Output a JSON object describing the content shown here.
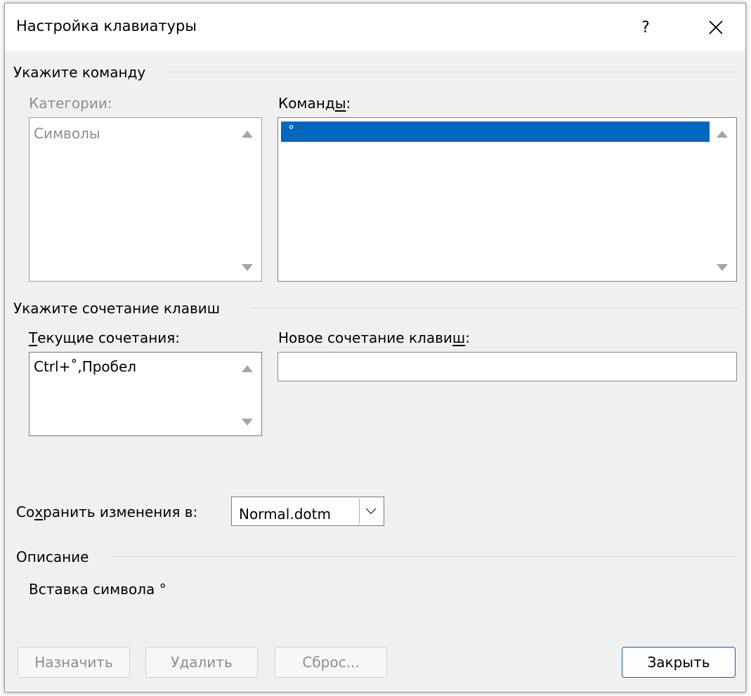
{
  "window": {
    "title": "Настройка клавиатуры",
    "help_label": "?",
    "close_icon": "close-icon"
  },
  "command_section": {
    "heading": "Укажите команду",
    "categories_label": "Категории:",
    "categories_items": [
      "Символы"
    ],
    "commands_label_pre": "Команд",
    "commands_label_u": "ы",
    "commands_label_post": ":",
    "commands_items": [
      "°"
    ],
    "selected_command_index": 0
  },
  "shortcut_section": {
    "heading": "Укажите сочетание клавиш",
    "current_label_u": "Т",
    "current_label_rest": "екущие сочетания:",
    "current_items": [
      "Ctrl+˚,Пробел"
    ],
    "new_label_pre": "Новое сочетание клави",
    "new_label_u": "ш",
    "new_label_post": ":",
    "new_value": ""
  },
  "save": {
    "label_pre": "Со",
    "label_u": "х",
    "label_post": "ранить изменения в:",
    "value": "Normal.dotm"
  },
  "description": {
    "heading": "Описание",
    "text": "Вставка символа °"
  },
  "buttons": {
    "assign": "Назначить",
    "remove": "Удалить",
    "reset": "Сброс...",
    "close": "Закрыть"
  },
  "colors": {
    "selection": "#0067c0",
    "disabled_text": "#8d8d8d",
    "dialog_bg": "#f0f0f0"
  }
}
